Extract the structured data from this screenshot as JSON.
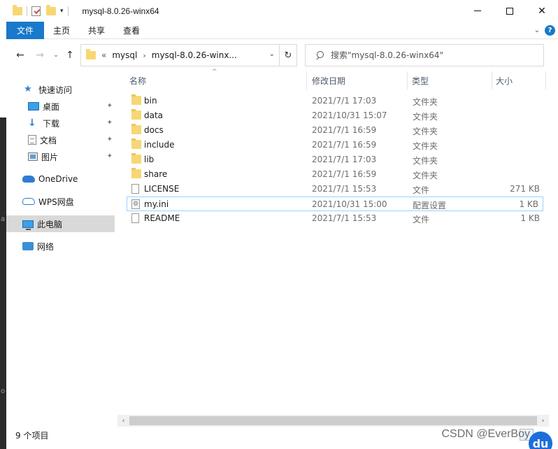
{
  "window": {
    "title": "mysql-8.0.26-winx64",
    "minimize": "—",
    "maximize": "☐",
    "close": "✕"
  },
  "ribbon": {
    "file": "文件",
    "tabs": [
      "主页",
      "共享",
      "查看"
    ],
    "expand": "⌄",
    "help": "?"
  },
  "nav": {
    "back": "←",
    "forward": "→",
    "recent": "⌄",
    "up": "↑",
    "breadcrumb_overflow": "«",
    "breadcrumbs": [
      "mysql",
      "mysql-8.0.26-winx..."
    ],
    "crumb_separator": "›",
    "address_dropdown": "⌄",
    "refresh": "↻",
    "search_placeholder": "搜索\"mysql-8.0.26-winx64\""
  },
  "sidebar": {
    "items": [
      {
        "label": "快速访问",
        "icon": "star-icon",
        "pinned": false
      },
      {
        "label": "桌面",
        "icon": "desktop-icon",
        "pinned": true
      },
      {
        "label": "下载",
        "icon": "download-icon",
        "pinned": true
      },
      {
        "label": "文档",
        "icon": "document-icon",
        "pinned": true
      },
      {
        "label": "图片",
        "icon": "picture-icon",
        "pinned": true
      },
      {
        "label": "OneDrive",
        "icon": "onedrive-cloud-icon",
        "pinned": false
      },
      {
        "label": "WPS网盘",
        "icon": "wps-cloud-icon",
        "pinned": false
      },
      {
        "label": "此电脑",
        "icon": "this-pc-icon",
        "pinned": false,
        "selected": true
      },
      {
        "label": "网络",
        "icon": "network-icon",
        "pinned": false
      }
    ],
    "pin_glyph": "📌"
  },
  "columns": {
    "name": "名称",
    "date": "修改日期",
    "type": "类型",
    "size": "大小",
    "sort_indicator": "^"
  },
  "files": [
    {
      "name": "bin",
      "date": "2021/7/1 17:03",
      "type": "文件夹",
      "size": "",
      "icon": "folder-icon"
    },
    {
      "name": "data",
      "date": "2021/10/31 15:07",
      "type": "文件夹",
      "size": "",
      "icon": "folder-icon"
    },
    {
      "name": "docs",
      "date": "2021/7/1 16:59",
      "type": "文件夹",
      "size": "",
      "icon": "folder-icon"
    },
    {
      "name": "include",
      "date": "2021/7/1 16:59",
      "type": "文件夹",
      "size": "",
      "icon": "folder-icon"
    },
    {
      "name": "lib",
      "date": "2021/7/1 17:03",
      "type": "文件夹",
      "size": "",
      "icon": "folder-icon"
    },
    {
      "name": "share",
      "date": "2021/7/1 16:59",
      "type": "文件夹",
      "size": "",
      "icon": "folder-icon"
    },
    {
      "name": "LICENSE",
      "date": "2021/7/1 15:53",
      "type": "文件",
      "size": "271 KB",
      "icon": "file-icon"
    },
    {
      "name": "my.ini",
      "date": "2021/10/31 15:00",
      "type": "配置设置",
      "size": "1 KB",
      "icon": "ini-file-icon",
      "selected": true
    },
    {
      "name": "README",
      "date": "2021/7/1 15:53",
      "type": "文件",
      "size": "1 KB",
      "icon": "file-icon"
    }
  ],
  "scroll": {
    "left": "‹",
    "right": "›"
  },
  "status": {
    "count": "9 个项目"
  },
  "watermark": "CSDN @EverBoy",
  "logo_text": "du",
  "background_text": {
    "left_char_1": "a",
    "left_char_2": "o"
  },
  "colors": {
    "accent": "#1979ca",
    "folder": "#f7d774",
    "selection_border": "#99d1ff"
  }
}
